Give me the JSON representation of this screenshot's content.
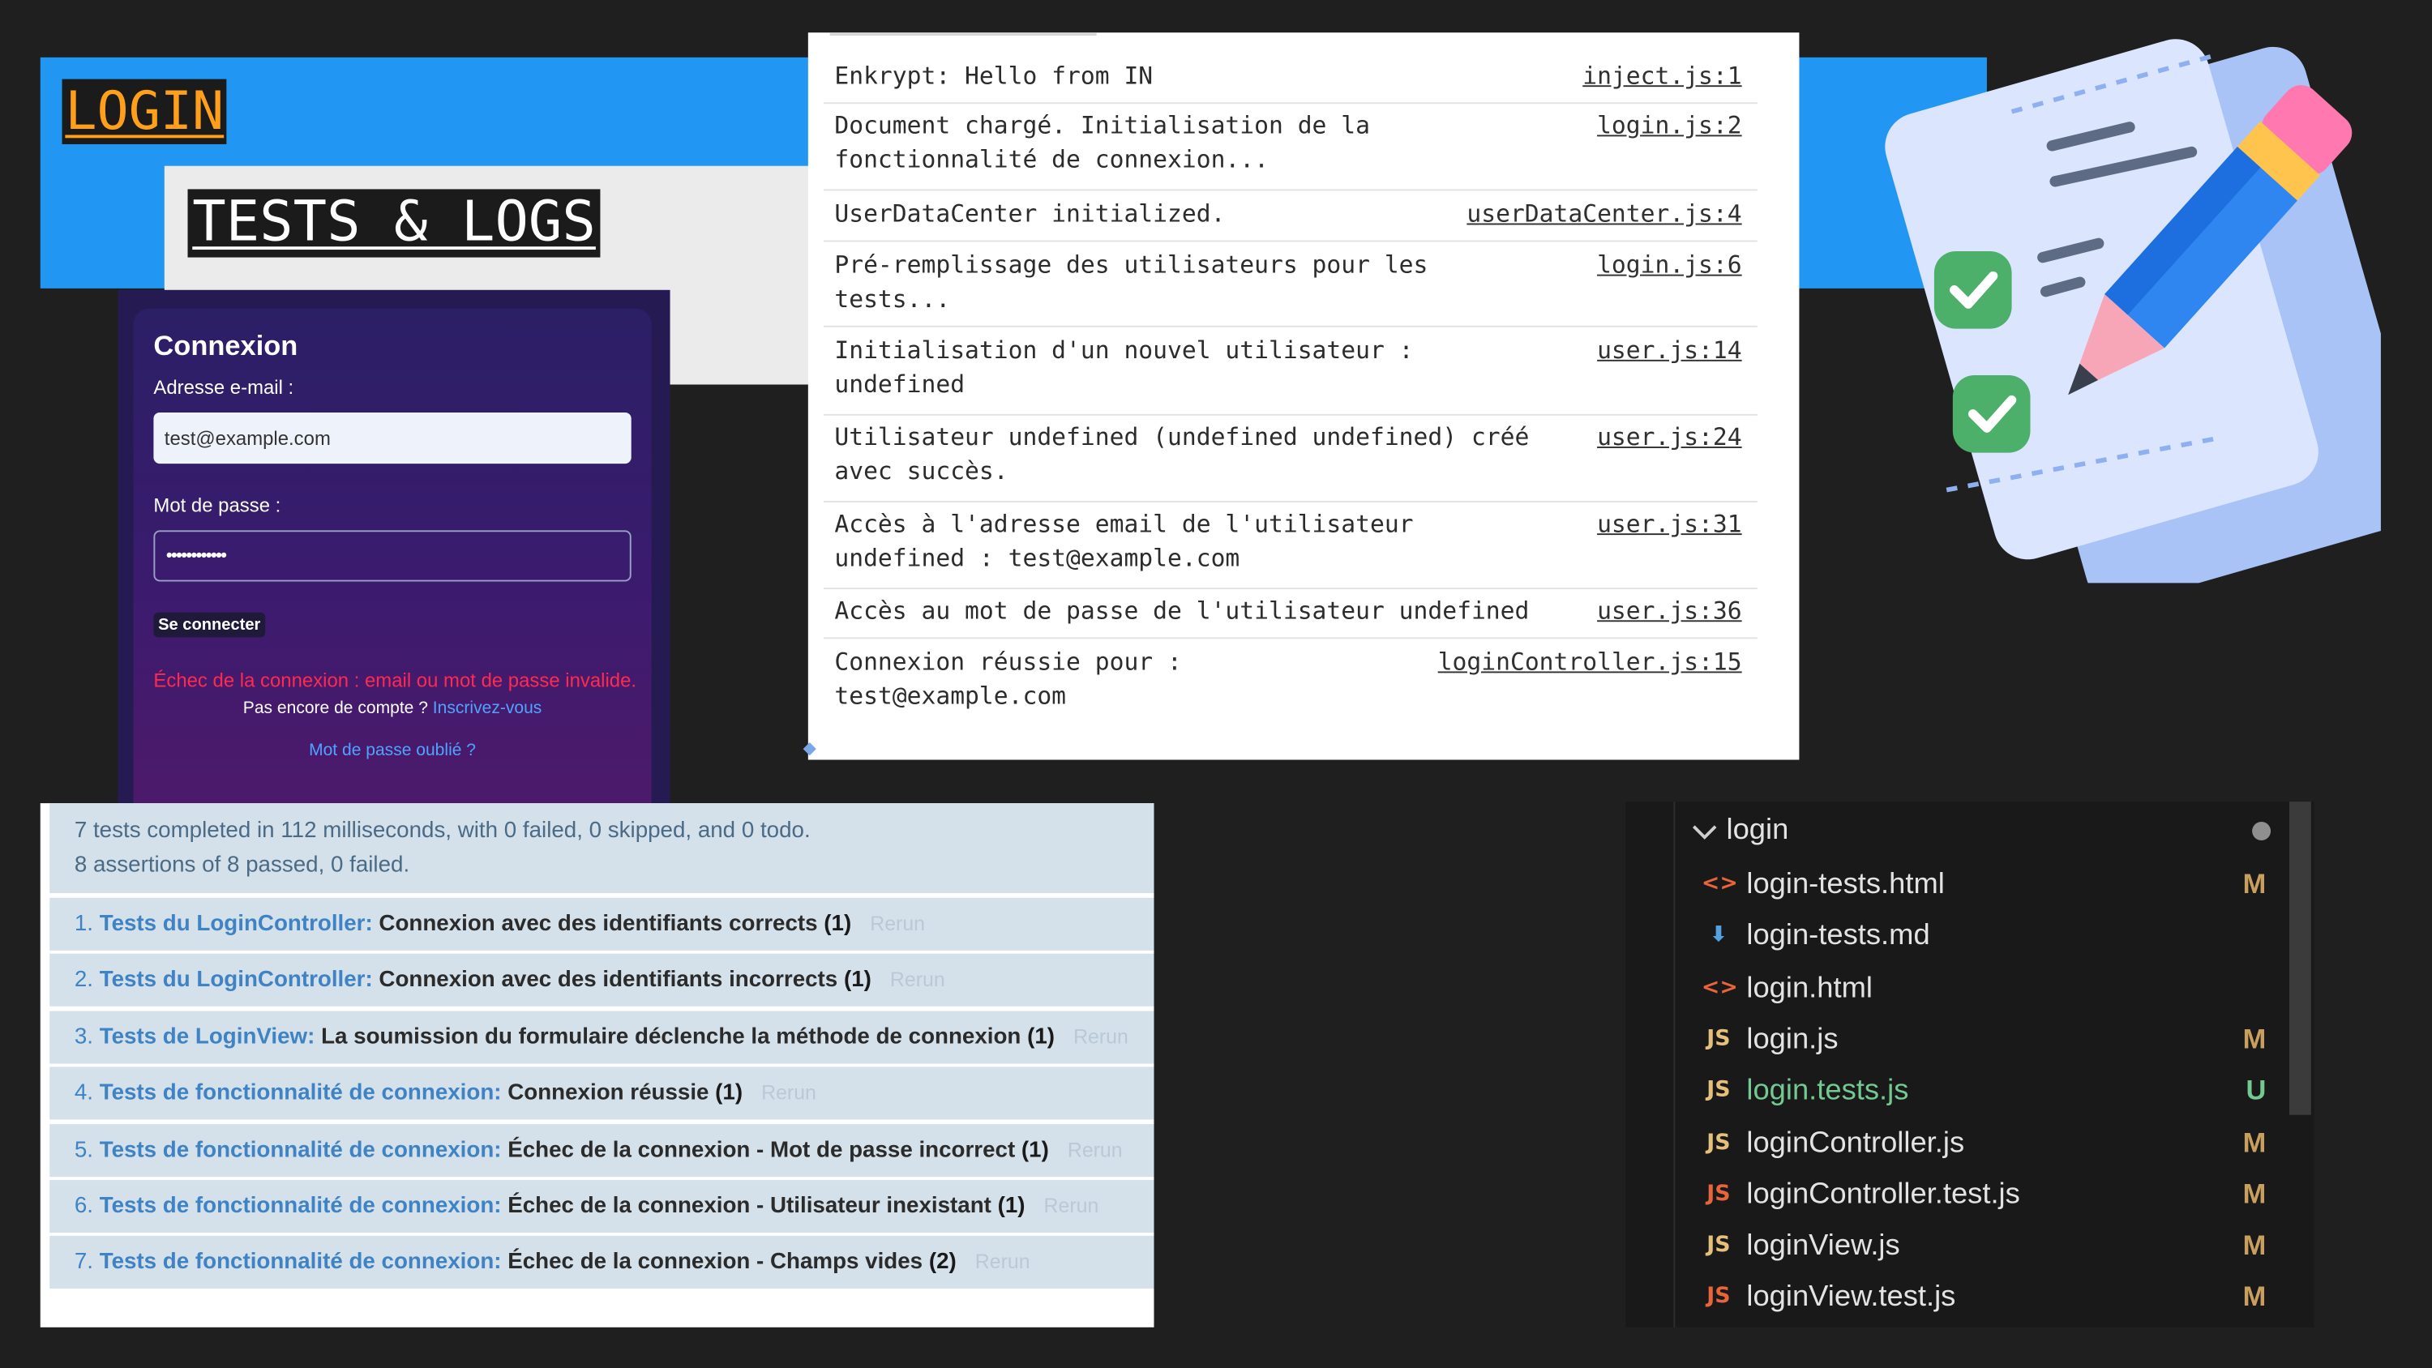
{
  "header": {
    "title": "LOGIN",
    "subtitle": "TESTS & LOGS"
  },
  "login_form": {
    "heading": "Connexion",
    "email_label": "Adresse e-mail :",
    "email_value": "test@example.com",
    "password_label": "Mot de passe :",
    "password_value": "••••••••••••",
    "submit_label": "Se connecter",
    "error_message": "Échec de la connexion : email ou mot de passe invalide.",
    "signup_text": "Pas encore de compte ?",
    "signup_link": "Inscrivez-vous",
    "forgot_link": "Mot de passe oublié ?"
  },
  "console": {
    "logs": [
      {
        "msg": "Enkrypt: Hello from IN",
        "src": "inject.js:1"
      },
      {
        "msg": "Document chargé. Initialisation de la\nfonctionnalité de connexion...",
        "src": "login.js:2"
      },
      {
        "msg": "UserDataCenter initialized.",
        "src": "userDataCenter.js:4"
      },
      {
        "msg": "Pré-remplissage des utilisateurs pour les\ntests...",
        "src": "login.js:6"
      },
      {
        "msg": "Initialisation d'un nouvel utilisateur :\nundefined",
        "src": "user.js:14"
      },
      {
        "msg": "Utilisateur undefined (undefined undefined) créé\navec succès.",
        "src": "user.js:24"
      },
      {
        "msg": "Accès à l'adresse email de l'utilisateur\nundefined : test@example.com",
        "src": "user.js:31"
      },
      {
        "msg": "Accès au mot de passe de l'utilisateur undefined",
        "src": "user.js:36"
      },
      {
        "msg": "Connexion réussie pour :\ntest@example.com",
        "src": "loginController.js:15"
      }
    ]
  },
  "qunit": {
    "summary_line1": "7 tests completed in 112 milliseconds, with 0 failed, 0 skipped, and 0 todo.",
    "summary_line2": "8 assertions of 8 passed, 0 failed.",
    "rerun_label": "Rerun",
    "tests": [
      {
        "num": "1.",
        "module": "Tests du LoginController:",
        "name": "Connexion avec des identifiants corrects",
        "count": "(1)"
      },
      {
        "num": "2.",
        "module": "Tests du LoginController:",
        "name": "Connexion avec des identifiants incorrects",
        "count": "(1)"
      },
      {
        "num": "3.",
        "module": "Tests de LoginView:",
        "name": "La soumission du formulaire déclenche la méthode de connexion",
        "count": "(1)"
      },
      {
        "num": "4.",
        "module": "Tests de fonctionnalité de connexion:",
        "name": "Connexion réussie",
        "count": "(1)"
      },
      {
        "num": "5.",
        "module": "Tests de fonctionnalité de connexion:",
        "name": "Échec de la connexion - Mot de passe incorrect",
        "count": "(1)"
      },
      {
        "num": "6.",
        "module": "Tests de fonctionnalité de connexion:",
        "name": "Échec de la connexion - Utilisateur inexistant",
        "count": "(1)"
      },
      {
        "num": "7.",
        "module": "Tests de fonctionnalité de connexion:",
        "name": "Échec de la connexion - Champs vides",
        "count": "(2)"
      }
    ]
  },
  "explorer": {
    "folder": "login",
    "files": [
      {
        "name": "login-tests.html",
        "icon": "html-icon",
        "glyph": "<>",
        "badge": "M"
      },
      {
        "name": "login-tests.md",
        "icon": "markdown-icon",
        "glyph": "⬇",
        "badge": ""
      },
      {
        "name": "login.html",
        "icon": "html-icon",
        "glyph": "<>",
        "badge": ""
      },
      {
        "name": "login.js",
        "icon": "js-icon",
        "glyph": "JS",
        "badge": "M"
      },
      {
        "name": "login.tests.js",
        "icon": "js-icon",
        "glyph": "JS",
        "badge": "U",
        "color": "#73c991"
      },
      {
        "name": "loginController.js",
        "icon": "js-icon",
        "glyph": "JS",
        "badge": "M"
      },
      {
        "name": "loginController.test.js",
        "icon": "js-test-icon",
        "glyph": "JS",
        "badge": "M"
      },
      {
        "name": "loginView.js",
        "icon": "js-icon",
        "glyph": "JS",
        "badge": "M"
      },
      {
        "name": "loginView.test.js",
        "icon": "js-test-icon",
        "glyph": "JS",
        "badge": "M"
      }
    ]
  },
  "colors": {
    "header_band": "#2196f3",
    "login_title": "#ff9f1c",
    "error": "#ff2a4d",
    "link": "#4fa3ff",
    "qunit_module": "#3f83c4",
    "untracked": "#73c991",
    "modified": "#c89f5f"
  }
}
